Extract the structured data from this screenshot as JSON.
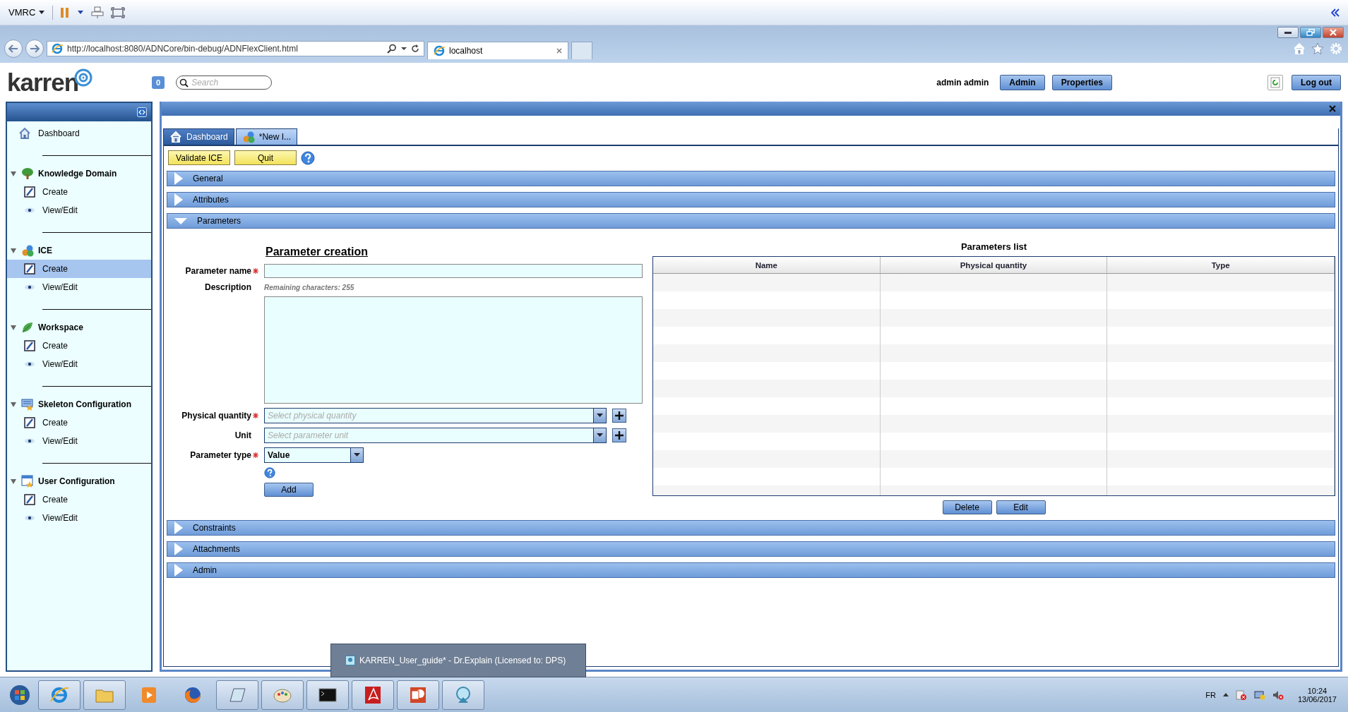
{
  "vmrc": {
    "menu": "VMRC"
  },
  "browser": {
    "url": "http://localhost:8080/ADNCore/bin-debug/ADNFlexClient.html",
    "tab": "localhost"
  },
  "header": {
    "logo": "karren",
    "badge": "0",
    "search": {
      "placeholder": "Search"
    },
    "user": "admin admin",
    "buttons": [
      "Admin",
      "Properties"
    ],
    "logout": "Log out"
  },
  "sidebar": {
    "items": [
      {
        "label": "Dashboard"
      }
    ],
    "groups": [
      {
        "label": "Knowledge Domain",
        "expanded": true,
        "items": [
          {
            "label": "Create",
            "selected": false
          },
          {
            "label": "View/Edit",
            "selected": false
          }
        ]
      },
      {
        "label": "ICE",
        "expanded": true,
        "items": [
          {
            "label": "Create",
            "selected": true
          },
          {
            "label": "View/Edit",
            "selected": false
          }
        ]
      },
      {
        "label": "Workspace",
        "expanded": true,
        "items": [
          {
            "label": "Create",
            "selected": false
          },
          {
            "label": "View/Edit",
            "selected": false
          }
        ]
      },
      {
        "label": "Skeleton Configuration",
        "expanded": true,
        "items": [
          {
            "label": "Create",
            "selected": false
          },
          {
            "label": "View/Edit",
            "selected": false
          }
        ]
      },
      {
        "label": "User Configuration",
        "expanded": true,
        "items": [
          {
            "label": "Create",
            "selected": false
          },
          {
            "label": "View/Edit",
            "selected": false
          }
        ]
      }
    ]
  },
  "tabs": [
    {
      "label": "Dashboard",
      "selected": false
    },
    {
      "label": "*New I...",
      "selected": true
    }
  ],
  "toolbar": {
    "buttons": [
      "Validate ICE",
      "Quit"
    ]
  },
  "sections_before": [
    {
      "title": "General",
      "expanded": false
    },
    {
      "title": "Attributes",
      "expanded": false
    },
    {
      "title": "Parameters",
      "expanded": true
    }
  ],
  "form": {
    "title": "Parameter creation",
    "name": {
      "label": "Parameter name",
      "required": true
    },
    "description": {
      "label": "Description",
      "remaining": "Remaining characters: 255"
    },
    "physical_quantity": {
      "label": "Physical quantity",
      "required": true,
      "placeholder": "Select physical quantity"
    },
    "unit": {
      "label": "Unit",
      "placeholder": "Select parameter unit"
    },
    "parameter_type": {
      "label": "Parameter type",
      "required": true,
      "value": "Value"
    },
    "add_button": "Add"
  },
  "parameters_list": {
    "title": "Parameters list",
    "columns": [
      "Name",
      "Physical quantity",
      "Type"
    ],
    "buttons": [
      "Delete",
      "Edit"
    ]
  },
  "sections_after": [
    {
      "title": "Constraints",
      "expanded": false
    },
    {
      "title": "Attachments",
      "expanded": false
    },
    {
      "title": "Admin",
      "expanded": false
    }
  ],
  "taskbar_preview": {
    "title": "KARREN_User_guide* - Dr.Explain (Licensed to: DPS)"
  },
  "taskbar": {
    "language": "FR",
    "time": "10:24",
    "date": "13/06/2017"
  }
}
